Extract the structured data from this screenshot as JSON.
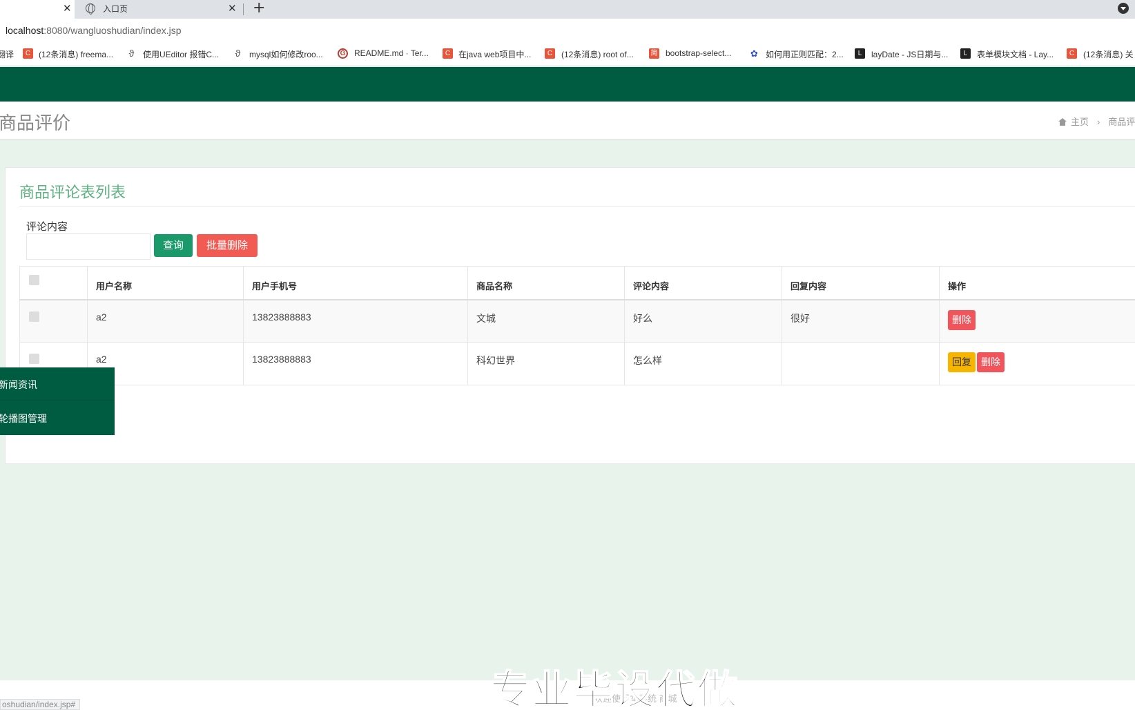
{
  "browser": {
    "tabs": [
      {
        "label": ""
      },
      {
        "label": "入口页"
      }
    ],
    "url_host": "localhost",
    "url_rest": ":8080/wangluoshudian/index.jsp",
    "bookmarks": [
      {
        "label": "翻译",
        "icon": "none"
      },
      {
        "label": "(12条消息) freema...",
        "icon": "csdn-icon"
      },
      {
        "label": "使用UEditor 报错C...",
        "icon": "paw-icon"
      },
      {
        "label": "mysql如何修改roo...",
        "icon": "paw-icon"
      },
      {
        "label": "README.md · Ter...",
        "icon": "gitee-icon"
      },
      {
        "label": "在java web项目中...",
        "icon": "csdn-icon"
      },
      {
        "label": "(12条消息) root of...",
        "icon": "csdn-icon"
      },
      {
        "label": "bootstrap-select...",
        "icon": "jianshu-icon"
      },
      {
        "label": "如何用正则匹配：2...",
        "icon": "baidu-icon"
      },
      {
        "label": "layDate - JS日期与...",
        "icon": "layui-icon"
      },
      {
        "label": "表单模块文档 - Lay...",
        "icon": "layui-icon"
      },
      {
        "label": "(12条消息) 关",
        "icon": "csdn-icon"
      }
    ],
    "status_url": "oshudian/index.jsp#"
  },
  "page": {
    "title": "商品评价",
    "breadcrumb": {
      "home": "主页",
      "current": "商品评"
    }
  },
  "card": {
    "title": "商品评论表列表",
    "search_label": "评论内容",
    "search_value": "",
    "query_button": "查询",
    "batch_delete_button": "批量删除"
  },
  "table": {
    "headers": [
      "用户名称",
      "用户手机号",
      "商品名称",
      "评论内容",
      "回复内容",
      "操作"
    ],
    "rows": [
      {
        "username": "a2",
        "phone": "13823888883",
        "product": "文城",
        "comment": "好么",
        "reply": "很好",
        "actions": [
          "删除"
        ]
      },
      {
        "username": "a2",
        "phone": "13823888883",
        "product": "科幻世界",
        "comment": "怎么样",
        "reply": "",
        "actions": [
          "回复",
          "删除"
        ]
      }
    ]
  },
  "sidemenu": {
    "items": [
      {
        "label": "新闻资讯"
      },
      {
        "label": "轮播图管理"
      }
    ]
  },
  "footer": {
    "text": "欢迎使用本系统 商城",
    "overlay": "专业毕设代做"
  },
  "colors": {
    "brand_green": "#005c40",
    "title_green": "#5fb282",
    "delete_red": "#f2545b",
    "reply_yellow": "#f7b500"
  }
}
